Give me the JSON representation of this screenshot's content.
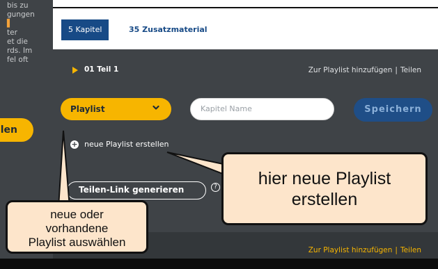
{
  "sidebar": {
    "text_lines": [
      "bis zu",
      "gungen",
      "",
      "ter",
      "et die",
      "rds. Im",
      "fel oft"
    ],
    "button_label": "len"
  },
  "tabs": [
    {
      "label": "5 Kapitel",
      "active": true
    },
    {
      "label": "35 Zusatzmaterial",
      "active": false
    }
  ],
  "chapter": {
    "title": "01 Teil 1",
    "add_to_playlist": "Zur Playlist hinzufügen",
    "separator": "|",
    "share": "Teilen"
  },
  "form": {
    "playlist_select": "Playlist",
    "chapter_name_placeholder": "Kapitel Name",
    "save_label": "Speichern",
    "new_playlist_label": "neue Playlist erstellen",
    "share_link_label": "Teilen-Link generieren",
    "help_symbol": "?"
  },
  "next_row": {
    "add_to_playlist": "Zur Playlist hinzufügen",
    "separator": "|",
    "share": "Teilen"
  },
  "callouts": {
    "right": [
      "hier neue Playlist",
      "erstellen"
    ],
    "left": [
      "neue oder",
      "vorhandene",
      "Playlist auswählen"
    ]
  },
  "colors": {
    "dark_panel": "#3f4347",
    "accent_yellow": "#f7b500",
    "brand_blue": "#174a86",
    "callout_fill": "#fde5cb"
  },
  "icons": [
    "triangle-right-icon",
    "chevron-down-icon",
    "plus-circle-icon",
    "help-icon"
  ]
}
